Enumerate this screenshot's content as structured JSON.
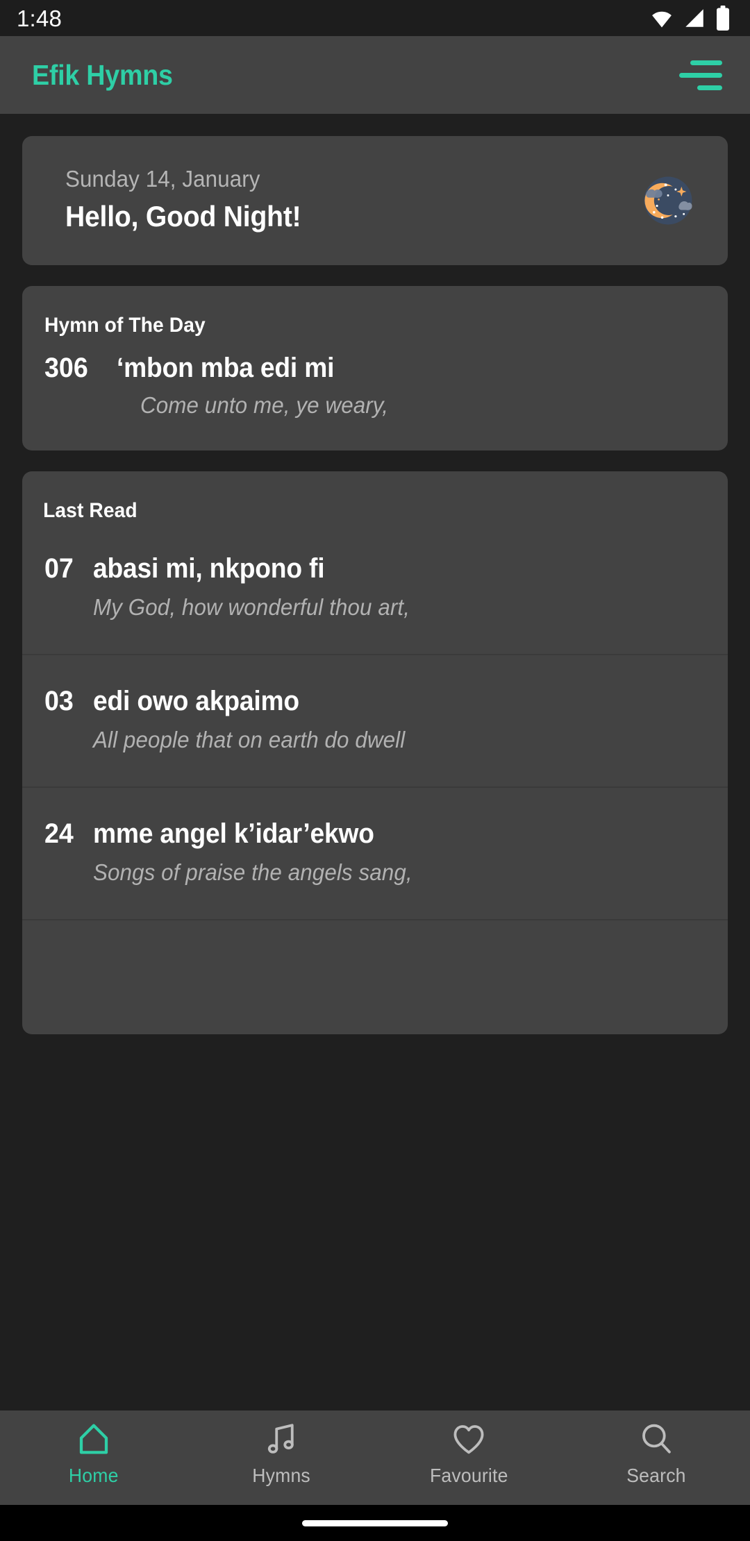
{
  "status_bar": {
    "time": "1:48",
    "icons": [
      "wifi-icon",
      "signal-icon",
      "battery-icon"
    ]
  },
  "app_bar": {
    "title": "Efik Hymns",
    "menu_icon": "hamburger-menu-icon",
    "accent_color": "#2ecfa6"
  },
  "greeting_card": {
    "date": "Sunday 14, January",
    "greeting": "Hello, Good Night!",
    "illustration": "night-moon-icon"
  },
  "hymn_of_the_day": {
    "section_title": "Hymn of The Day",
    "number": "306",
    "title": "‘mbon mba edi mi",
    "subtitle": "Come unto me, ye weary,"
  },
  "last_read": {
    "section_title": "Last Read",
    "items": [
      {
        "number": "07",
        "title": "abasi mi, nkpono fi",
        "subtitle": "My God, how wonderful thou art,"
      },
      {
        "number": "03",
        "title": "edi owo akpaimo",
        "subtitle": "All people that on earth do dwell"
      },
      {
        "number": "24",
        "title": "mme angel k’idar’ekwo",
        "subtitle": "Songs of praise the angels sang,"
      },
      {
        "number": "",
        "title": "",
        "subtitle": ""
      }
    ]
  },
  "bottom_nav": {
    "items": [
      {
        "label": "Home",
        "icon": "home-icon",
        "active": true
      },
      {
        "label": "Hymns",
        "icon": "music-note-icon",
        "active": false
      },
      {
        "label": "Favourite",
        "icon": "heart-icon",
        "active": false
      },
      {
        "label": "Search",
        "icon": "search-icon",
        "active": false
      }
    ],
    "active_color": "#2ecfa6",
    "inactive_color": "#bdbdbd"
  },
  "colors": {
    "background": "#1f1f1f",
    "card": "#434343",
    "accent": "#2ecfa6",
    "primary_text": "#ffffff",
    "secondary_text": "#b2b2b2"
  }
}
